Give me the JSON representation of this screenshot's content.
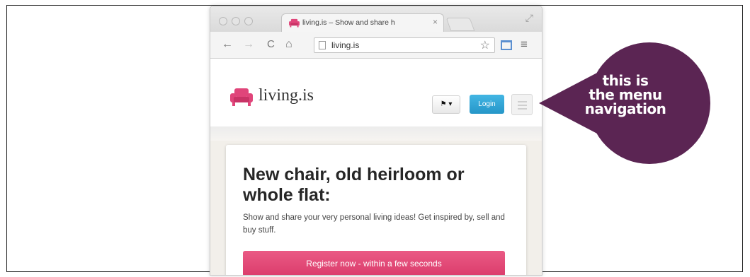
{
  "browser": {
    "tab_title": "living.is – Show and share h",
    "tab_close": "×",
    "url": "living.is",
    "nav": {
      "back": "←",
      "forward": "→",
      "reload": "C",
      "home": "⌂"
    },
    "star": "☆",
    "menu": "≡",
    "maximize": "⤢"
  },
  "site": {
    "logo_text": "living.is",
    "flag_dropdown": "⚑ ▾",
    "login_label": "Login"
  },
  "hero": {
    "title": "New chair, old heirloom or whole flat:",
    "text": "Show and share your very personal living ideas! Get inspired by, sell and buy stuff.",
    "register_label": "Register now - within a few seconds"
  },
  "annotation": {
    "lines": [
      "this is",
      "the menu",
      "navigation"
    ],
    "color": "#5b2553"
  },
  "colors": {
    "brand_pink": "#e0457a",
    "login_blue": "#2fa5d6"
  }
}
